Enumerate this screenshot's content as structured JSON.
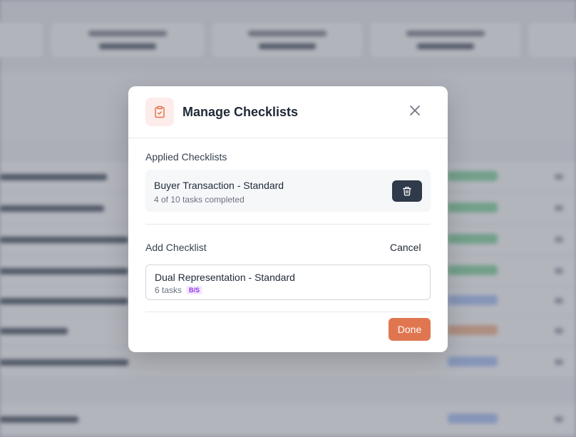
{
  "modal": {
    "title": "Manage Checklists",
    "icon": "clipboard-check-icon",
    "accent_color": "#e07650",
    "applied_section": {
      "label": "Applied Checklists",
      "items": [
        {
          "name": "Buyer Transaction - Standard",
          "progress": "4 of 10 tasks completed"
        }
      ]
    },
    "add_section": {
      "label": "Add Checklist",
      "cancel_label": "Cancel",
      "options": [
        {
          "name": "Dual Representation - Standard",
          "tasks": "6 tasks",
          "tag": "B/S"
        }
      ]
    },
    "done_label": "Done"
  }
}
